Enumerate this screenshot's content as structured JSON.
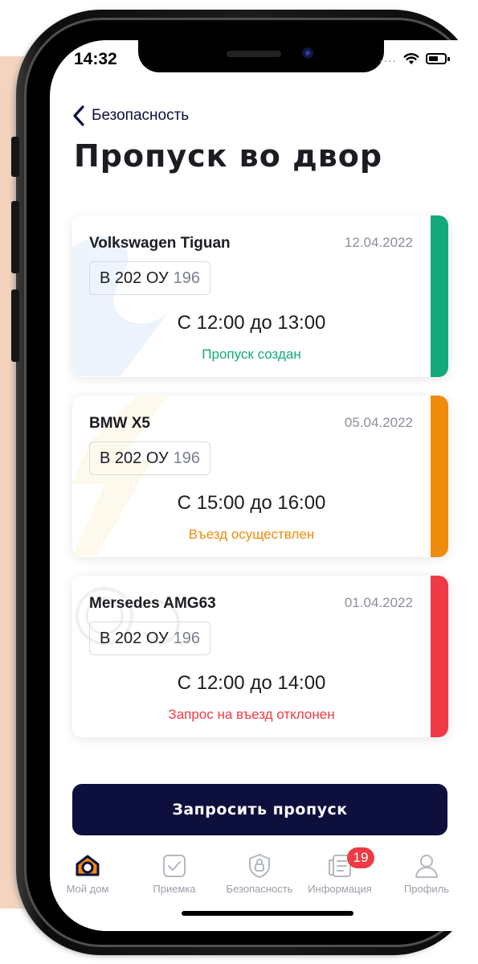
{
  "status_bar": {
    "time": "14:32"
  },
  "nav": {
    "back_label": "Безопасность"
  },
  "page": {
    "title": "Пропуск во двор"
  },
  "passes": [
    {
      "car": "Volkswagen Tiguan",
      "date": "12.04.2022",
      "plate": "В 202 ОУ",
      "region": "196",
      "time": "С 12:00 до 13:00",
      "status": "Пропуск создан",
      "color": "#13a97b"
    },
    {
      "car": "BMW X5",
      "date": "05.04.2022",
      "plate": "В 202 ОУ",
      "region": "196",
      "time": "С 15:00 до 16:00",
      "status": "Въезд осуществлен",
      "color": "#f08c0c"
    },
    {
      "car": "Mersedes AMG63",
      "date": "01.04.2022",
      "plate": "В 202 ОУ",
      "region": "196",
      "time": "С 12:00 до 14:00",
      "status": "Запрос на въезд отклонен",
      "color": "#ee3a45"
    }
  ],
  "request_button": {
    "label": "Запросить пропуск"
  },
  "tabbar": {
    "items": [
      {
        "label": "Мой дом",
        "icon": "home-icon",
        "active": true
      },
      {
        "label": "Приемка",
        "icon": "checkbox-icon"
      },
      {
        "label": "Безопасность",
        "icon": "lock-shield-icon"
      },
      {
        "label": "Информация",
        "icon": "newspaper-icon",
        "badge": "19"
      },
      {
        "label": "Профиль",
        "icon": "user-icon"
      }
    ]
  },
  "colors": {
    "primary": "#0d0f3d",
    "accent": "#f08c0c",
    "background": "#f4d3bf"
  }
}
